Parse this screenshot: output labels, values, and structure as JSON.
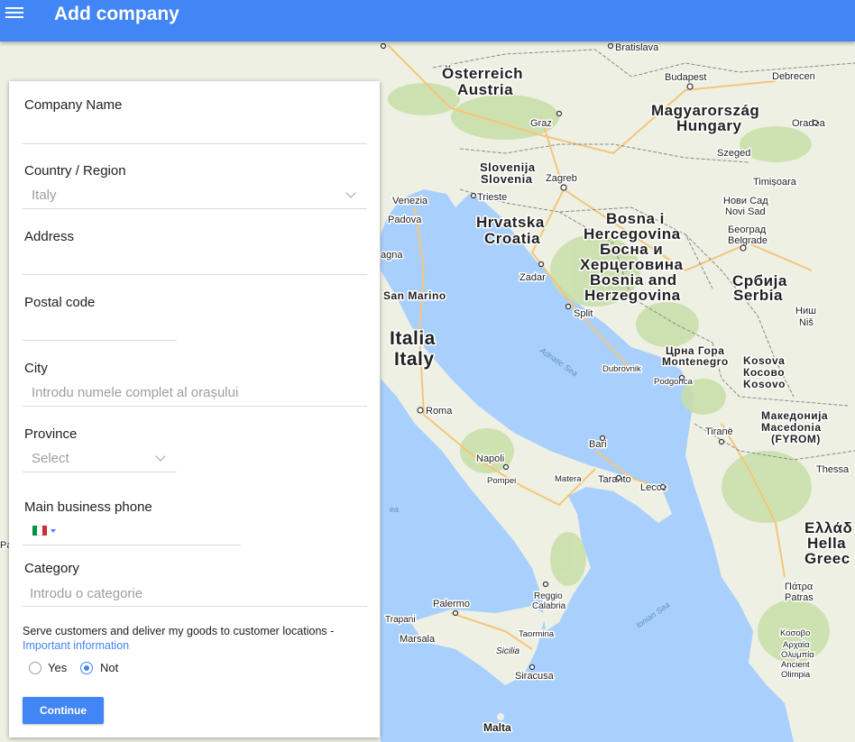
{
  "header": {
    "menu_icon": "hamburger-menu-icon",
    "title": "Add company",
    "color": "#4285f4"
  },
  "form": {
    "company_name": {
      "label": "Company Name",
      "value": ""
    },
    "country": {
      "label": "Country / Region",
      "value": "Italy"
    },
    "address": {
      "label": "Address",
      "value": ""
    },
    "postal_code": {
      "label": "Postal code",
      "value": ""
    },
    "city": {
      "label": "City",
      "placeholder": "Introdu numele complet al orașului"
    },
    "province": {
      "label": "Province",
      "value": "Select"
    },
    "phone": {
      "label": "Main business phone",
      "flag": "italy-flag-icon"
    },
    "category": {
      "label": "Category",
      "placeholder": "Introdu o categorie"
    },
    "serve": {
      "text": "Serve customers and deliver my goods to customer locations -",
      "link": "Important information",
      "options": [
        "Yes",
        "Not"
      ],
      "selected": "Not"
    },
    "continue_label": "Continue"
  },
  "map": {
    "countries": {
      "austria_local": "Österreich",
      "austria": "Austria",
      "hungary_local": "Magyarország",
      "hungary": "Hungary",
      "slovenia_local": "Slovenija",
      "slovenia": "Slovenia",
      "croatia_local": "Hrvatska",
      "croatia": "Croatia",
      "bih1": "Bosna i",
      "bih2": "Hercegovina",
      "bih3": "Босна и",
      "bih4": "Херцеговина",
      "bih5": "Bosnia and",
      "bih6": "Herzegovina",
      "serbia_local": "Србија",
      "serbia": "Serbia",
      "montenegro_local": "Црна Гора",
      "montenegro": "Montenegro",
      "kosovo1": "Kosova",
      "kosovo2": "Косово",
      "kosovo3": "Kosovo",
      "italy_local": "Italia",
      "italy": "Italy",
      "sanmarino": "San Marino",
      "macedonia1": "Македонија",
      "macedonia2": "Macedonia",
      "macedonia3": "(FYROM)",
      "greece1": "Ελλάδ",
      "greece2": "Hella",
      "greece3": "Greec"
    },
    "cities": {
      "bratislava": "Bratislava",
      "budapest": "Budapest",
      "debrecen": "Debrecen",
      "oradea": "Oradea",
      "graz": "Graz",
      "szeged": "Szeged",
      "zagreb": "Zagreb",
      "trieste": "Trieste",
      "venezia": "Venezia",
      "padova": "Padova",
      "timisoara": "Timișoara",
      "novisad1": "Нови Сад",
      "novisad2": "Novi Sad",
      "beograd1": "Београд",
      "beograd2": "Belgrade",
      "zadar": "Zadar",
      "split": "Split",
      "nis1": "Ниш",
      "nis2": "Niš",
      "dubrovnik": "Dubrovnik",
      "podgorica": "Podgorica",
      "roma": "Roma",
      "tirane": "Tiranë",
      "bari": "Bari",
      "napoli": "Napoli",
      "pompei": "Pompei",
      "matera": "Matera",
      "taranto": "Taranto",
      "lecce": "Lecce",
      "thessa": "Thessa",
      "palermo": "Palermo",
      "reggio1": "Reggio",
      "reggio2": "Calabria",
      "trapani": "Trapani",
      "marsala": "Marsala",
      "taormina": "Taormina",
      "sicilia": "Sicilia",
      "siracusa": "Siracusa",
      "malta": "Malta",
      "patra1": "Πάτρα",
      "patra2": "Patras",
      "olympia1": "Αρχαία",
      "olympia2": "Ολυμπία",
      "olympia3": "Ancient",
      "olympia4": "Olimpia",
      "kosovo_g": "Κοσοβο",
      "ragna": "agna",
      "pa": "Pa"
    },
    "seas": {
      "adriatic": "Adriatic Sea",
      "ionian": "Ionian Sea",
      "tyr": "ea"
    },
    "colors": {
      "land": "#eef0e4",
      "water": "#a9d0fd",
      "green": "#c8dfa8",
      "border": "#7e7e7e",
      "road": "#f5c57a"
    }
  }
}
